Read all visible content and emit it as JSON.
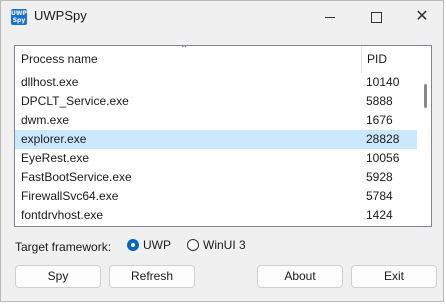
{
  "window": {
    "title": "UWPSpy",
    "app_icon": "uwpspy-app-icon",
    "icon_text_top": "UWP",
    "icon_text_bottom": "Spy"
  },
  "titlebar_buttons": {
    "minimize_icon": "minimize-icon",
    "maximize_icon": "maximize-icon",
    "close_icon": "close-icon",
    "close_glyph": "✕"
  },
  "process_list": {
    "columns": [
      "Process name",
      "PID"
    ],
    "sort_glyph": "⌃",
    "rows": [
      {
        "name": "dllhost.exe",
        "pid": "10140",
        "selected": false
      },
      {
        "name": "DPCLT_Service.exe",
        "pid": "5888",
        "selected": false
      },
      {
        "name": "dwm.exe",
        "pid": "1676",
        "selected": false
      },
      {
        "name": "explorer.exe",
        "pid": "28828",
        "selected": true
      },
      {
        "name": "EyeRest.exe",
        "pid": "10056",
        "selected": false
      },
      {
        "name": "FastBootService.exe",
        "pid": "5928",
        "selected": false
      },
      {
        "name": "FirewallSvc64.exe",
        "pid": "5784",
        "selected": false
      },
      {
        "name": "fontdrvhost.exe",
        "pid": "1424",
        "selected": false
      }
    ],
    "selected_color": "#cce8ff"
  },
  "framework": {
    "label": "Target framework:",
    "options": [
      {
        "label": "UWP",
        "checked": true
      },
      {
        "label": "WinUI 3",
        "checked": false
      }
    ]
  },
  "buttons": {
    "spy": "Spy",
    "refresh": "Refresh",
    "about": "About",
    "exit": "Exit"
  },
  "colors": {
    "accent": "#0067c0"
  }
}
